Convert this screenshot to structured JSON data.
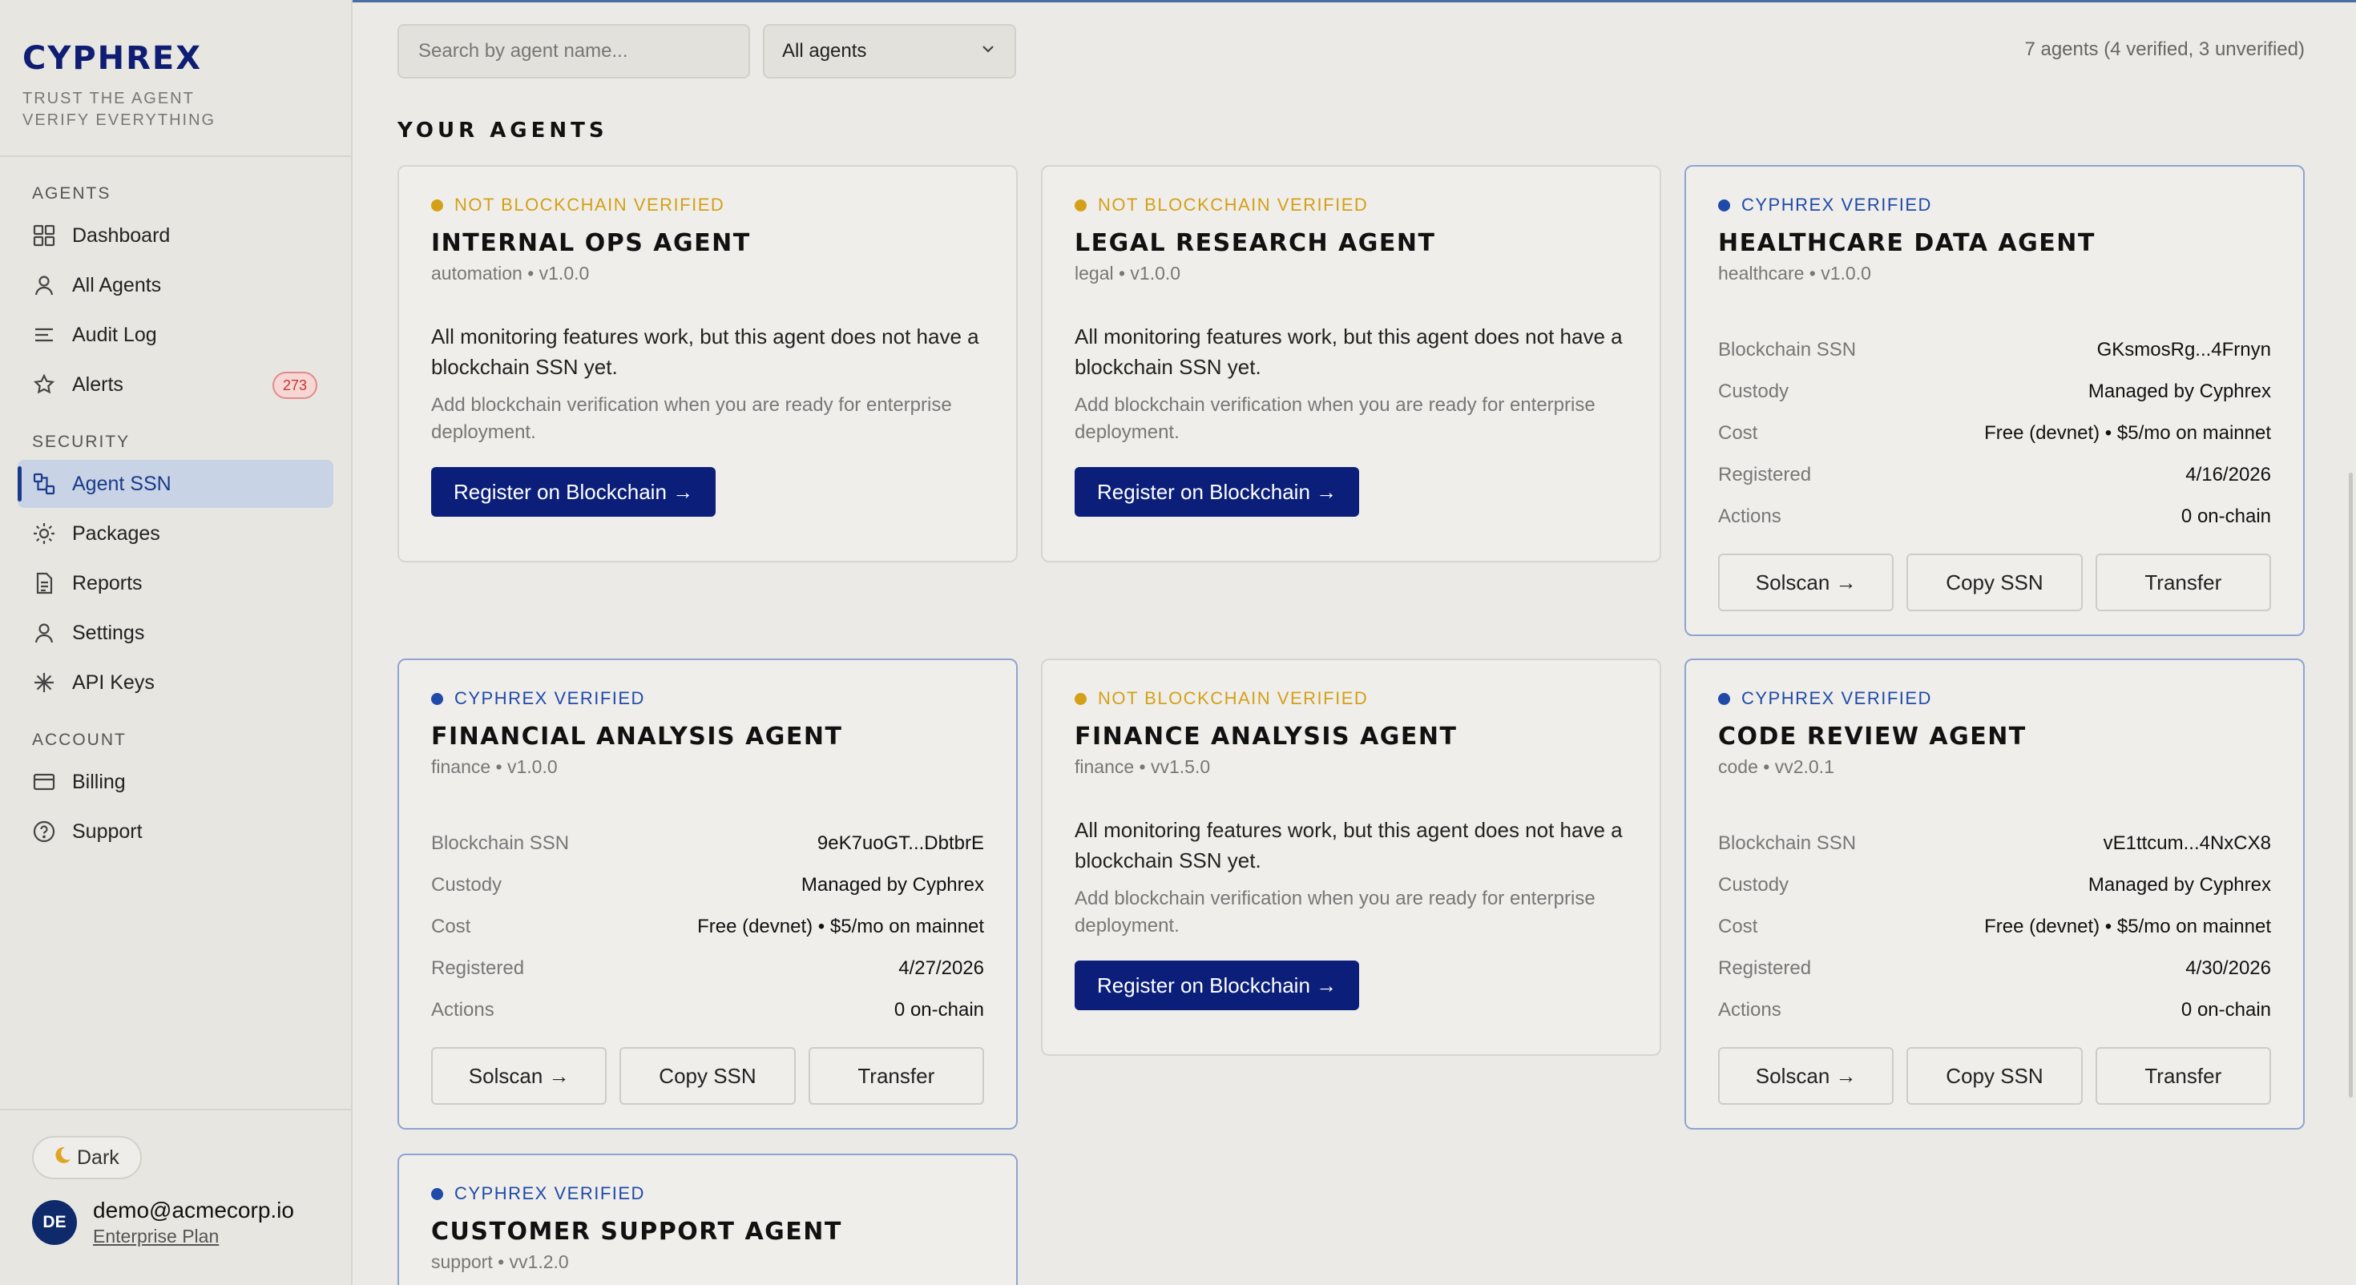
{
  "brand": {
    "logo": "CYPHREX",
    "tagline_1": "TRUST THE AGENT",
    "tagline_2": "VERIFY EVERYTHING",
    "logo_color": "#0f1e73"
  },
  "nav": {
    "agents_heading": "AGENTS",
    "dashboard": "Dashboard",
    "all_agents": "All Agents",
    "audit_log": "Audit Log",
    "alerts": "Alerts",
    "alerts_count": "273",
    "security_heading": "SECURITY",
    "agent_ssn": "Agent SSN",
    "packages": "Packages",
    "reports": "Reports",
    "settings": "Settings",
    "api_keys": "API Keys",
    "account_heading": "ACCOUNT",
    "billing": "Billing",
    "support": "Support"
  },
  "footer": {
    "theme_icon": "moon-icon",
    "theme_label": "Dark",
    "avatar_initials": "DE",
    "email": "demo@acmecorp.io",
    "plan": "Enterprise Plan"
  },
  "toolbar": {
    "search_placeholder": "Search by agent name...",
    "filter_value": "All agents",
    "count_text": "7 agents (4 verified, 3 unverified)"
  },
  "section_title": "YOUR AGENTS",
  "labels": {
    "not_verified": "NOT BLOCKCHAIN VERIFIED",
    "verified": "CYPHREX VERIFIED",
    "unverified_msg": "All monitoring features work, but this agent does not have a blockchain SSN yet.",
    "unverified_submsg": "Add blockchain verification when you are ready for enterprise deployment.",
    "register_btn": "Register on Blockchain →",
    "k_ssn": "Blockchain SSN",
    "k_custody": "Custody",
    "k_cost": "Cost",
    "k_registered": "Registered",
    "k_actions": "Actions",
    "solscan": "Solscan →",
    "copy_ssn": "Copy SSN",
    "transfer": "Transfer"
  },
  "colors": {
    "verified": "#1f4aa8",
    "not_verified": "#d4a017",
    "primary_button": "#0b1f7a",
    "alert_badge": "#c0392b"
  },
  "agents": [
    {
      "name": "INTERNAL OPS AGENT",
      "meta": "automation • v1.0.0",
      "verified": false
    },
    {
      "name": "LEGAL RESEARCH AGENT",
      "meta": "legal • v1.0.0",
      "verified": false
    },
    {
      "name": "HEALTHCARE DATA AGENT",
      "meta": "healthcare • v1.0.0",
      "verified": true,
      "ssn": "GKsmosRg...4Frnyn",
      "custody": "Managed by Cyphrex",
      "cost": "Free (devnet) • $5/mo on mainnet",
      "registered": "4/16/2026",
      "actions": "0 on-chain"
    },
    {
      "name": "FINANCIAL ANALYSIS AGENT",
      "meta": "finance • v1.0.0",
      "verified": true,
      "ssn": "9eK7uoGT...DbtbrE",
      "custody": "Managed by Cyphrex",
      "cost": "Free (devnet) • $5/mo on mainnet",
      "registered": "4/27/2026",
      "actions": "0 on-chain"
    },
    {
      "name": "FINANCE ANALYSIS AGENT",
      "meta": "finance • vv1.5.0",
      "verified": false
    },
    {
      "name": "CODE REVIEW AGENT",
      "meta": "code • vv2.0.1",
      "verified": true,
      "ssn": "vE1ttcum...4NxCX8",
      "custody": "Managed by Cyphrex",
      "cost": "Free (devnet) • $5/mo on mainnet",
      "registered": "4/30/2026",
      "actions": "0 on-chain"
    },
    {
      "name": "CUSTOMER SUPPORT AGENT",
      "meta": "support • vv1.2.0",
      "verified": true
    }
  ]
}
